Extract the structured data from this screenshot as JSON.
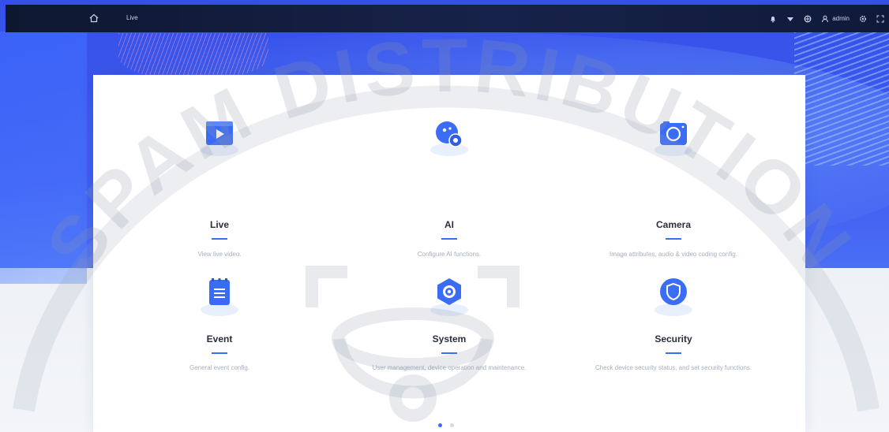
{
  "topbar": {
    "crumb": "Live",
    "user": "admin",
    "icons": [
      "home-icon",
      "bell-icon",
      "wifi-icon",
      "globe-icon",
      "user-icon",
      "gear-icon",
      "fullscreen-icon"
    ]
  },
  "modules": [
    {
      "title": "Live",
      "desc": "View live video.",
      "icon": "live-icon"
    },
    {
      "title": "AI",
      "desc": "Configure AI functions.",
      "icon": "ai-icon"
    },
    {
      "title": "Camera",
      "desc": "Image attributes, audio & video coding config.",
      "icon": "camera-icon"
    },
    {
      "title": "Event",
      "desc": "General event config.",
      "icon": "event-icon"
    },
    {
      "title": "System",
      "desc": "User management, device operation and maintenance.",
      "icon": "system-icon"
    },
    {
      "title": "Security",
      "desc": "Check device security status, and set security functions.",
      "icon": "security-icon"
    }
  ],
  "watermark": "SPAM DISTRIBUTION",
  "pagination": {
    "pages": 2,
    "current": 1
  },
  "colors": {
    "accent": "#3b6cf5",
    "topbar": "#101a38",
    "bg_blue": "#3e5cf0"
  }
}
